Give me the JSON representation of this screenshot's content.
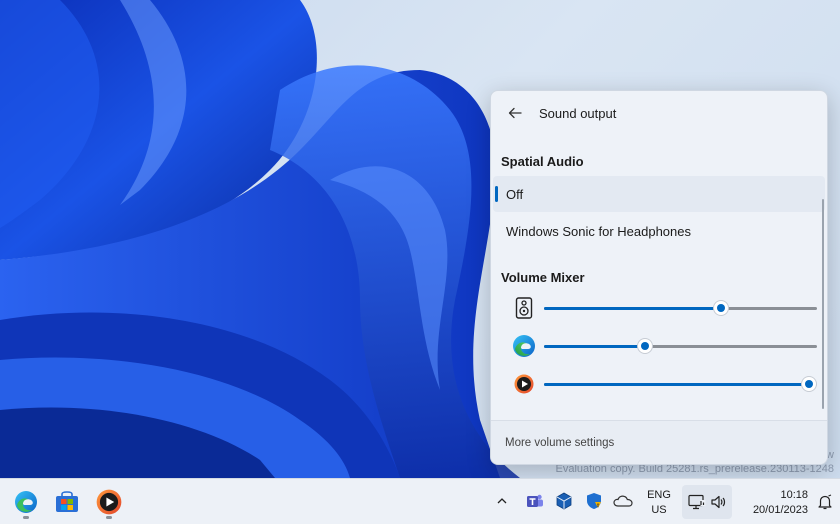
{
  "flyout": {
    "title": "Sound output",
    "spatial_audio": {
      "heading": "Spatial Audio",
      "options": [
        {
          "label": "Off",
          "selected": true
        },
        {
          "label": "Windows Sonic for Headphones",
          "selected": false
        }
      ]
    },
    "volume_mixer": {
      "heading": "Volume Mixer",
      "apps": [
        {
          "icon": "speaker-icon",
          "volume_fraction": 0.65
        },
        {
          "icon": "edge-icon",
          "volume_fraction": 0.37
        },
        {
          "icon": "media-player-icon",
          "volume_fraction": 0.97
        }
      ]
    },
    "footer_link": "More volume settings"
  },
  "taskbar": {
    "apps": [
      "edge-icon",
      "store-icon",
      "media-player-icon"
    ],
    "tray_icons": [
      "chevron-up-icon",
      "teams-icon",
      "virtualbox-icon",
      "defender-icon",
      "onedrive-icon"
    ],
    "lang_line1": "ENG",
    "lang_line2": "US",
    "time": "10:18",
    "date": "20/01/2023"
  },
  "watermark": {
    "line1": "w",
    "line2": "Evaluation copy. Build 25281.rs_prerelease.230113-1248"
  },
  "colors": {
    "accent": "#0067c0",
    "flyout_bg": "#eef2f8",
    "wallpaper_blue": "#1846d6"
  }
}
